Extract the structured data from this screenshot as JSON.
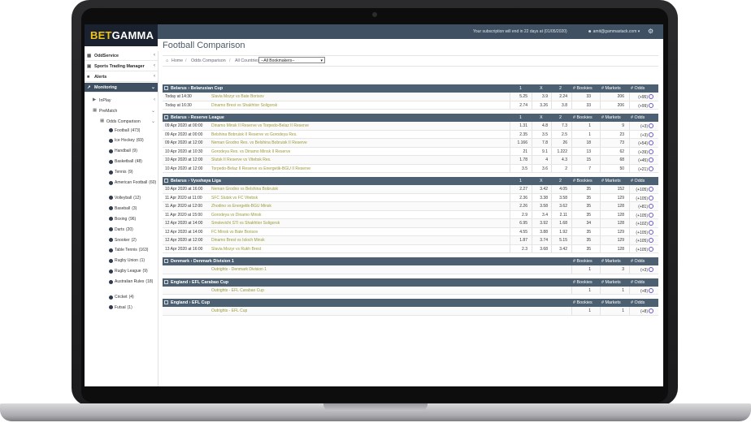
{
  "brand": {
    "part1": "BET",
    "part2": "GAMMA",
    "accent": "#f0c419"
  },
  "topbar": {
    "subscription_text": "Your subscription will end in 22 days at (01/05/2020)",
    "user_email": "amit@gammastack.com",
    "user_icon": "user-icon",
    "settings_icon": "gear-icon"
  },
  "sidebar": {
    "items": [
      {
        "label": "OddService",
        "icon": "grid-icon"
      },
      {
        "label": "Sports Trading Manager",
        "icon": "trading-icon"
      },
      {
        "label": "Alerts",
        "icon": "bell-icon"
      },
      {
        "label": "Monitoring",
        "icon": "chart-icon",
        "active": true
      }
    ],
    "sub": {
      "inplay": "InPlay",
      "prematch": "PreMatch",
      "odds_comparison": "Odds Comparison"
    },
    "sports": [
      {
        "label": "Football",
        "count": "(473)"
      },
      {
        "label": "Ice Hockey",
        "count": "(69)"
      },
      {
        "label": "Handball",
        "count": "(9)"
      },
      {
        "label": "Basketball",
        "count": "(48)"
      },
      {
        "label": "Tennis",
        "count": "(9)"
      },
      {
        "label": "American Football",
        "count": "(60)"
      },
      {
        "label": "Volleyball",
        "count": "(12)"
      },
      {
        "label": "Baseball",
        "count": "(3)"
      },
      {
        "label": "Boxing",
        "count": "(96)"
      },
      {
        "label": "Darts",
        "count": "(20)"
      },
      {
        "label": "Snooker",
        "count": "(2)"
      },
      {
        "label": "Table Tennis",
        "count": "(163)"
      },
      {
        "label": "Rugby Union",
        "count": "(1)"
      },
      {
        "label": "Rugby League",
        "count": "(9)"
      },
      {
        "label": "Australian Rules",
        "count": "(18)"
      },
      {
        "label": "Cricket",
        "count": "(4)"
      },
      {
        "label": "Futsal",
        "count": "(1)"
      }
    ]
  },
  "page": {
    "title": "Football Comparison",
    "breadcrumb": {
      "home": "Home",
      "level1": "Odds Comparison",
      "level2": "All Countries"
    },
    "bookmakers_select": "--All Bookmakers--"
  },
  "columns": {
    "one": "1",
    "x": "X",
    "two": "2",
    "bookies": "# Bookies",
    "markets": "# Markets",
    "odds": "# Odds"
  },
  "leagues": [
    {
      "name": "Belarus › Belarusian Cup",
      "rows": [
        {
          "time": "Today at 14:30",
          "match": "Slavia Mozyr vs Bate Borisov",
          "o1": "5.25",
          "ox": "3.9",
          "o2": "2.24",
          "bookies": "33",
          "markets": "206",
          "odds": "(+95)"
        },
        {
          "time": "Today at 16:30",
          "match": "Dinamo Brest vs Shakhtior Soligorsk",
          "o1": "2.74",
          "ox": "3.26",
          "o2": "3.8",
          "bookies": "33",
          "markets": "206",
          "odds": "(+99)"
        }
      ]
    },
    {
      "name": "Belarus › Reserve League",
      "rows": [
        {
          "time": "09 Apr 2020 at 00:00",
          "match": "Dinamo Minsk II Reserve vs Torpedo-Belaz II Reserve",
          "o1": "1.31",
          "ox": "4.8",
          "o2": "7.3",
          "bookies": "1",
          "markets": "9",
          "odds": "(+3)"
        },
        {
          "time": "09 Apr 2020 at 00:00",
          "match": "Belshina Bobruisk II Reserve vs Gorodeya Res.",
          "o1": "2.35",
          "ox": "3.5",
          "o2": "2.5",
          "bookies": "1",
          "markets": "23",
          "odds": "(+3)"
        },
        {
          "time": "09 Apr 2020 at 12:00",
          "match": "Neman Grodno Res. vs Belshina Bobruisk II Reserve",
          "o1": "1.166",
          "ox": "7.8",
          "o2": "26",
          "bookies": "18",
          "markets": "73",
          "odds": "(+54)"
        },
        {
          "time": "10 Apr 2020 at 10:30",
          "match": "Gorodeya Res. vs Dinamo Minsk II Reserve",
          "o1": "21",
          "ox": "9.1",
          "o2": "1.222",
          "bookies": "13",
          "markets": "62",
          "odds": "(+39)"
        },
        {
          "time": "10 Apr 2020 at 12:00",
          "match": "Slutsk II Reserve vs Vitebsk Res.",
          "o1": "1.78",
          "ox": "4",
          "o2": "4.3",
          "bookies": "15",
          "markets": "68",
          "odds": "(+45)"
        },
        {
          "time": "10 Apr 2020 at 12:00",
          "match": "Torpedo-Belaz II Reserve vs Energetik-BGU II Reserve",
          "o1": "3.5",
          "ox": "3.6",
          "o2": "2",
          "bookies": "7",
          "markets": "50",
          "odds": "(+21)"
        }
      ]
    },
    {
      "name": "Belarus › Vysshaya Liga",
      "rows": [
        {
          "time": "10 Apr 2020 at 16:00",
          "match": "Neman Grodno vs Belshina Bobruisk",
          "o1": "2.27",
          "ox": "3.42",
          "o2": "4.05",
          "bookies": "35",
          "markets": "152",
          "odds": "(+105)"
        },
        {
          "time": "11 Apr 2020 at 11:00",
          "match": "SFC Slutsk vs FC Vitebsk",
          "o1": "2.36",
          "ox": "3.38",
          "o2": "3.58",
          "bookies": "35",
          "markets": "129",
          "odds": "(+105)"
        },
        {
          "time": "11 Apr 2020 at 12:00",
          "match": "Zhodino vs Energetik-BGU Minsk",
          "o1": "2.26",
          "ox": "3.58",
          "o2": "3.62",
          "bookies": "35",
          "markets": "128",
          "odds": "(+81)"
        },
        {
          "time": "11 Apr 2020 at 15:00",
          "match": "Gorodeya vs Dinamo Minsk",
          "o1": "2.9",
          "ox": "3.4",
          "o2": "2.11",
          "bookies": "35",
          "markets": "128",
          "odds": "(+105)"
        },
        {
          "time": "12 Apr 2020 at 14:00",
          "match": "Smolevichi STI vs Shakhtior Soligorsk",
          "o1": "6.95",
          "ox": "3.92",
          "o2": "1.68",
          "bookies": "34",
          "markets": "128",
          "odds": "(+102)"
        },
        {
          "time": "12 Apr 2020 at 14:00",
          "match": "FC Minsk vs Bate Borisov",
          "o1": "4.55",
          "ox": "3.88",
          "o2": "1.92",
          "bookies": "35",
          "markets": "129",
          "odds": "(+105)"
        },
        {
          "time": "12 Apr 2020 at 12:00",
          "match": "Dinamo Brest vs Isloch Minsk",
          "o1": "1.87",
          "ox": "3.74",
          "o2": "5.15",
          "bookies": "35",
          "markets": "129",
          "odds": "(+105)"
        },
        {
          "time": "13 Apr 2020 at 16:00",
          "match": "Slavia Mozyr vs Rukh Brest",
          "o1": "2.3",
          "ox": "3.68",
          "o2": "3.42",
          "bookies": "35",
          "markets": "128",
          "odds": "(+105)"
        }
      ]
    },
    {
      "name": "Denmark › Denmark Division 1",
      "outright": true,
      "rows": [
        {
          "match": "Outrights - Denmark Division 1",
          "bookies": "1",
          "markets": "3",
          "odds": "(+3)"
        }
      ]
    },
    {
      "name": "England › EFL Carabao Cup",
      "outright": true,
      "rows": [
        {
          "match": "Outrights - EFL Carabao Cup",
          "bookies": "1",
          "markets": "1",
          "odds": "(+8)"
        }
      ]
    },
    {
      "name": "England › EFL Cup",
      "outright": true,
      "rows": [
        {
          "match": "Outrights - EFL Cup",
          "bookies": "1",
          "markets": "1",
          "odds": "(+8)"
        }
      ]
    }
  ]
}
